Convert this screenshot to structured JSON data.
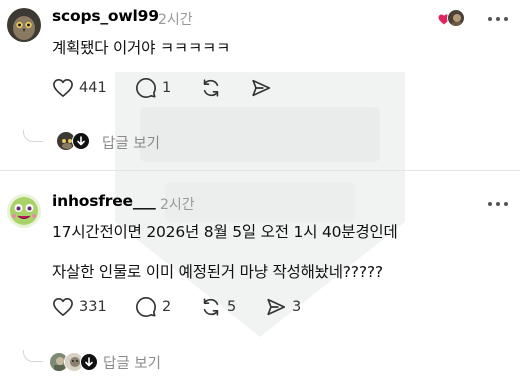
{
  "posts": [
    {
      "username": "scops_owl99",
      "time": "2시간",
      "lines": [
        "계획됐다 이거야 ㅋㅋㅋㅋㅋ"
      ],
      "likes": "441",
      "comments": "1",
      "reposts": "",
      "shares": "",
      "replies_label": "답글 보기"
    },
    {
      "username": "inhosfree___",
      "time": "2시간",
      "lines": [
        "17시간전이면 2026년 8월 5일 오전 1시 40분경인데",
        "자살한 인물로 이미 예정된거 마냥 작성해놨네?????"
      ],
      "likes": "331",
      "comments": "2",
      "reposts": "5",
      "shares": "3",
      "replies_label": "답글 보기"
    }
  ],
  "icons": {
    "like": "heart-icon",
    "comment": "comment-icon",
    "repost": "repost-icon",
    "share": "send-icon",
    "more": "more-horizontal-icon"
  },
  "colors": {
    "reaction_heart": "#e0245e",
    "muted_text": "#999999",
    "watermark": "#e9ecea"
  }
}
